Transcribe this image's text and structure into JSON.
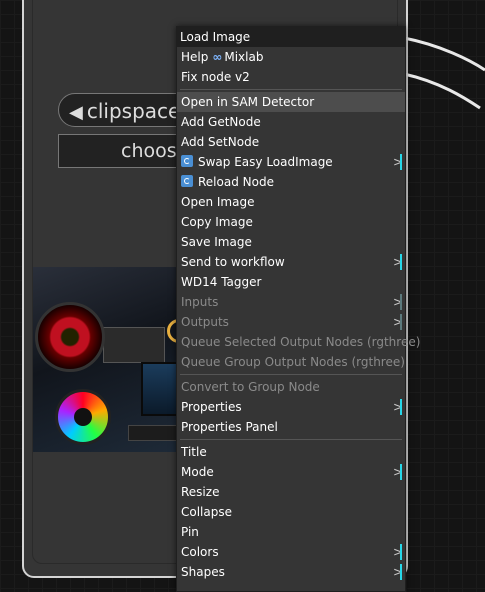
{
  "node": {
    "clipspace_label": "clipspace",
    "choose_label": "choose"
  },
  "menu": {
    "title": "Load Image",
    "groups": [
      {
        "items": [
          {
            "name": "help",
            "label": "Help",
            "extra": "Mixlab",
            "disabled": false,
            "submenu": false
          },
          {
            "name": "fix-node-v2",
            "label": "Fix node v2",
            "disabled": false,
            "submenu": false
          }
        ]
      },
      {
        "items": [
          {
            "name": "open-in-sam-detector",
            "label": "Open in SAM Detector",
            "disabled": false,
            "submenu": false,
            "hover": true
          },
          {
            "name": "add-getnode",
            "label": "Add GetNode",
            "disabled": false,
            "submenu": false
          },
          {
            "name": "add-setnode",
            "label": "Add SetNode",
            "disabled": false,
            "submenu": false
          },
          {
            "name": "swap-easy-loadimage",
            "label": "Swap Easy LoadImage",
            "icon": "swap-icon",
            "disabled": false,
            "submenu": true
          },
          {
            "name": "reload-node",
            "label": "Reload Node",
            "icon": "reload-icon",
            "disabled": false,
            "submenu": false
          },
          {
            "name": "open-image",
            "label": "Open Image",
            "disabled": false,
            "submenu": false
          },
          {
            "name": "copy-image",
            "label": "Copy Image",
            "disabled": false,
            "submenu": false
          },
          {
            "name": "save-image",
            "label": "Save Image",
            "disabled": false,
            "submenu": false
          },
          {
            "name": "send-to-workflow",
            "label": "Send to workflow",
            "disabled": false,
            "submenu": true
          },
          {
            "name": "wd14-tagger",
            "label": "WD14 Tagger",
            "disabled": false,
            "submenu": false
          },
          {
            "name": "inputs",
            "label": "Inputs",
            "disabled": true,
            "submenu": true
          },
          {
            "name": "outputs",
            "label": "Outputs",
            "disabled": true,
            "submenu": true
          },
          {
            "name": "queue-selected-output-nodes",
            "label": "Queue Selected Output Nodes (rgthree)",
            "disabled": true,
            "submenu": false
          },
          {
            "name": "queue-group-output-nodes",
            "label": "Queue Group Output Nodes (rgthree)",
            "disabled": true,
            "submenu": false
          }
        ]
      },
      {
        "items": [
          {
            "name": "convert-to-group-node",
            "label": "Convert to Group Node",
            "disabled": true,
            "submenu": false
          },
          {
            "name": "properties",
            "label": "Properties",
            "disabled": false,
            "submenu": true
          },
          {
            "name": "properties-panel",
            "label": "Properties Panel",
            "disabled": false,
            "submenu": false
          }
        ]
      },
      {
        "items": [
          {
            "name": "title",
            "label": "Title",
            "disabled": false,
            "submenu": false
          },
          {
            "name": "mode",
            "label": "Mode",
            "disabled": false,
            "submenu": true
          },
          {
            "name": "resize",
            "label": "Resize",
            "disabled": false,
            "submenu": false
          },
          {
            "name": "collapse",
            "label": "Collapse",
            "disabled": false,
            "submenu": false
          },
          {
            "name": "pin",
            "label": "Pin",
            "disabled": false,
            "submenu": false
          },
          {
            "name": "colors",
            "label": "Colors",
            "disabled": false,
            "submenu": true
          },
          {
            "name": "shapes",
            "label": "Shapes",
            "disabled": false,
            "submenu": true
          }
        ]
      }
    ]
  },
  "colors": {
    "submenu_accent": "#27d7e8",
    "menu_bg": "#353535",
    "hover_bg": "#4d4d4d"
  }
}
